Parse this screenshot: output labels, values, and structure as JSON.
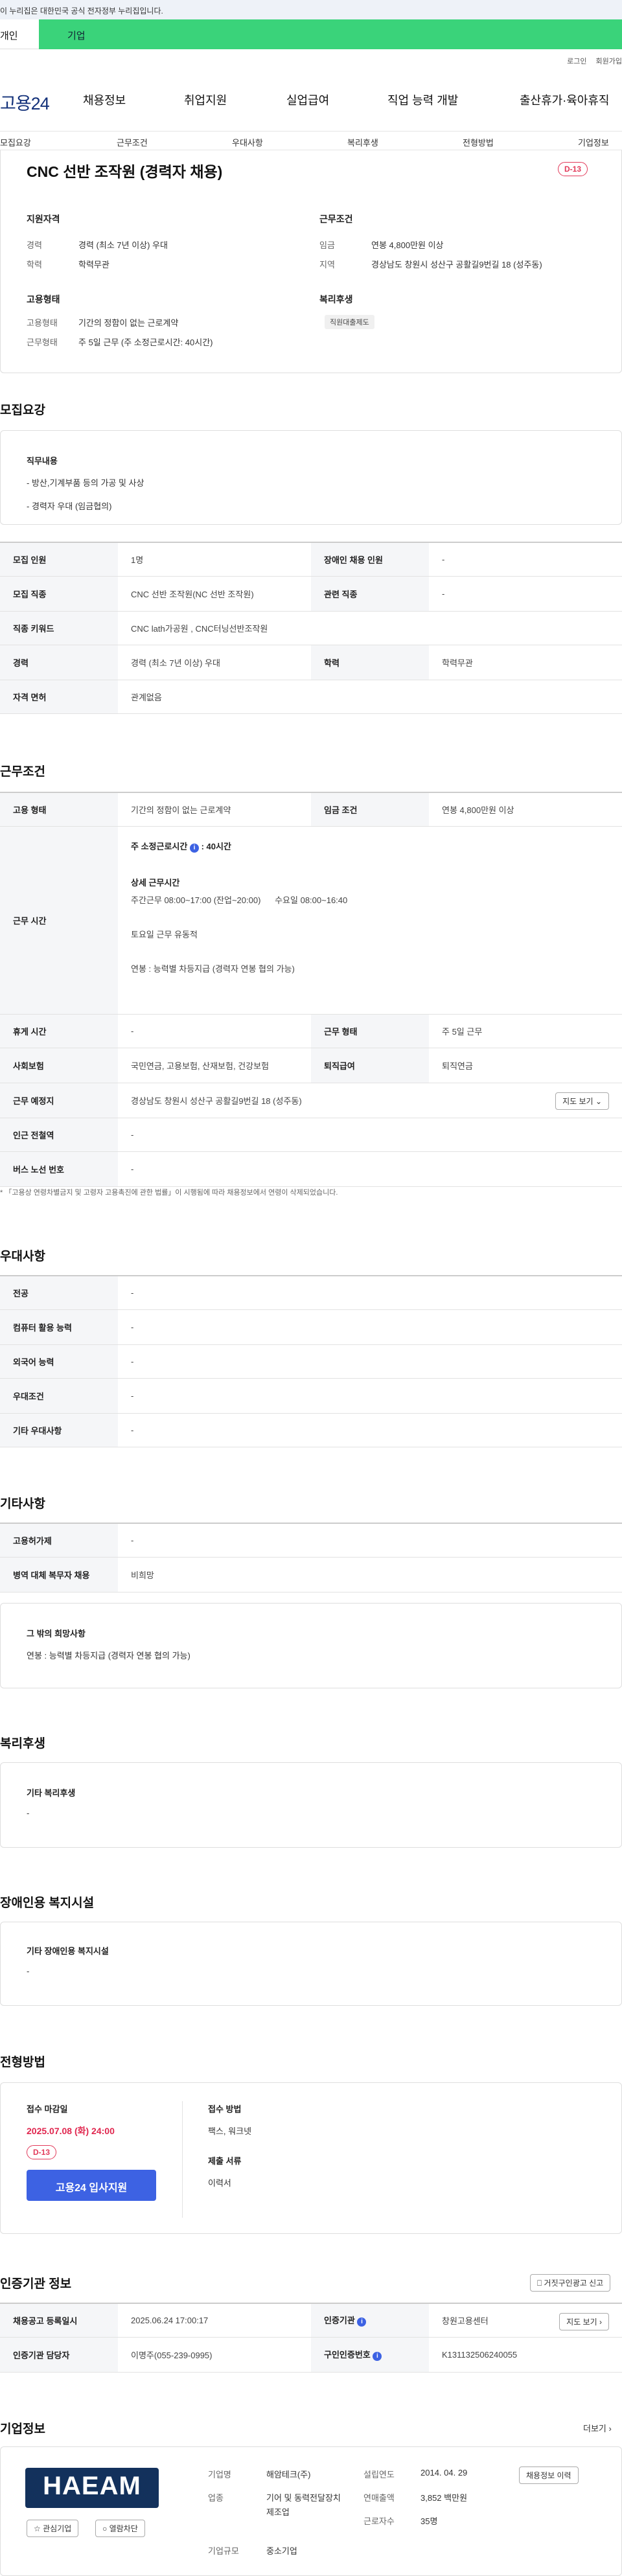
{
  "gov_banner": "이 누리집은 대한민국 공식 전자정부 누리집입니다.",
  "top_tabs": {
    "personal": "개인",
    "company": "기업"
  },
  "util": {
    "login": "로그인",
    "join": "회원가입"
  },
  "logo": "고용24",
  "gnb": [
    "채용정보",
    "취업지원",
    "실업급여",
    "직업 능력 개발",
    "출산휴가·육아휴직"
  ],
  "subnav": [
    "모집요강",
    "근무조건",
    "우대사항",
    "복리후생",
    "전형방법",
    "기업정보"
  ],
  "summary": {
    "title": "CNC 선반 조작원 (경력자 채용)",
    "dday": "D-13",
    "qual_title": "지원자격",
    "qual_rows": [
      {
        "k": "경력",
        "v": "경력 (최소 7년 이상) 우대"
      },
      {
        "k": "학력",
        "v": "학력무관"
      }
    ],
    "emp_title": "고용형태",
    "emp_rows": [
      {
        "k": "고용형태",
        "v": "기간의 정함이 없는 근로계약"
      },
      {
        "k": "근무형태",
        "v": "주 5일 근무 (주 소정근로시간: 40시간)"
      }
    ],
    "cond_title": "근무조건",
    "cond_rows": [
      {
        "k": "임금",
        "v": "연봉 4,800만원 이상"
      },
      {
        "k": "지역",
        "v": "경상남도 창원시 성산구 공활길9번길 18 (성주동)"
      }
    ],
    "welfare_title": "복리후생",
    "welfare_badge": "직원대출제도"
  },
  "recruit": {
    "title": "모집요강",
    "duty_title": "직무내용",
    "duty_lines": [
      "- 방산,기계부품 등의 가공 및 사상",
      "- 경력자 우대 (임금협의)"
    ],
    "rows": [
      [
        "모집 인원",
        "1명",
        "장애인 채용 인원",
        "-"
      ],
      [
        "모집 직종",
        "CNC 선반 조작원(NC 선반 조작원)",
        "관련 직종",
        "-"
      ],
      [
        "직종 키워드",
        "CNC lath가공원 , CNC터닝선반조작원"
      ],
      [
        "경력",
        "경력 (최소 7년 이상) 우대",
        "학력",
        "학력무관"
      ],
      [
        "자격 면허",
        "관계없음"
      ]
    ]
  },
  "work": {
    "title": "근무조건",
    "emp_k": "고용 형태",
    "emp_v": "기간의 정함이 없는 근로계약",
    "wage_k": "임금 조건",
    "wage_v": "연봉 4,800만원 이상",
    "hours_k": "근무 시간",
    "hours_main": "주 소정근로시간",
    "hours_main_v": "40시간",
    "detail_title": "상세 근무시간",
    "detail_1": "주간근무  08:00~17:00 (잔업~20:00)",
    "detail_2": "수요일 08:00~16:40",
    "detail_3": "토요일 근무  유동적",
    "detail_4": "연봉 : 능력별 차등지급 (경력자 연봉 협의 가능)",
    "rows": [
      [
        "휴게 시간",
        "-",
        "근무 형태",
        "주 5일 근무"
      ],
      [
        "사회보험",
        "국민연금, 고용보험, 산재보험, 건강보험",
        "퇴직급여",
        "퇴직연금"
      ]
    ],
    "place_k": "근무 예정지",
    "place_v": "경상남도 창원시 성산구 공활길9번길 18 (성주동)",
    "map_btn": "지도 보기",
    "station_k": "인근 전철역",
    "station_v": "-",
    "bus_k": "버스 노선 번호",
    "bus_v": "-",
    "note": "* 「고용상 연령차별금지 및 고령자 고용촉진에 관한 법률」이 시행됨에 따라 채용정보에서 연령이 삭제되었습니다."
  },
  "pref": {
    "title": "우대사항",
    "rows": [
      [
        "전공",
        "-"
      ],
      [
        "컴퓨터 활용 능력",
        "-"
      ],
      [
        "외국어 능력",
        "-"
      ],
      [
        "우대조건",
        "-"
      ],
      [
        "기타 우대사항",
        "-"
      ]
    ]
  },
  "etc": {
    "title": "기타사항",
    "rows": [
      [
        "고용허가제",
        "-"
      ],
      [
        "병역 대체 복무자 채용",
        "비희망"
      ]
    ],
    "box_title": "그 밖의 희망사항",
    "box_text": "연봉 : 능력별 차등지급 (경력자 연봉 협의 가능)"
  },
  "welfare": {
    "title": "복리후생",
    "box_title": "기타 복리후생",
    "box_text": "-"
  },
  "disability": {
    "title": "장애인용 복지시설",
    "box_title": "기타 장애인용 복지시설",
    "box_text": "-"
  },
  "selection": {
    "title": "전형방법",
    "deadline_title": "접수 마감일",
    "deadline": "2025.07.08 (화) 24:00",
    "dday": "D-13",
    "apply_btn": "고용24 입사지원",
    "method_title": "접수 방법",
    "method": "팩스, 워크넷",
    "docs_title": "제출 서류",
    "docs": "이력서"
  },
  "agency": {
    "title": "인증기관 정보",
    "report_btn": "거짓구인광고 신고",
    "rows": [
      [
        "채용공고 등록일시",
        "2025.06.24 17:00:17",
        "인증기관",
        "창원고용센터"
      ],
      [
        "인증기관 담당자",
        "이명주(055-239-0995)",
        "구인인증번호",
        "K131132506240055"
      ]
    ],
    "map_btn": "지도 보기"
  },
  "company": {
    "title": "기업정보",
    "more": "더보기",
    "logo_text": "HAEAM",
    "fav_btn": "관심기업",
    "block_btn": "열람차단",
    "name_k": "기업명",
    "name_v": "해암테크(주)",
    "industry_k": "업종",
    "industry_v": "기어 및 동력전달장치 제조업",
    "size_k": "기업규모",
    "size_v": "중소기업",
    "founded_k": "설립연도",
    "founded_v": "2014. 04. 29",
    "sales_k": "연매출액",
    "sales_v": "3,852 백만원",
    "staff_k": "근로자수",
    "staff_v": "35명",
    "history_btn": "채용정보 이력"
  },
  "colors": {
    "accent": "#3d62e3",
    "dday": "#e23a5a",
    "green_tab": "#3ad37a",
    "logo": "#13317a"
  }
}
